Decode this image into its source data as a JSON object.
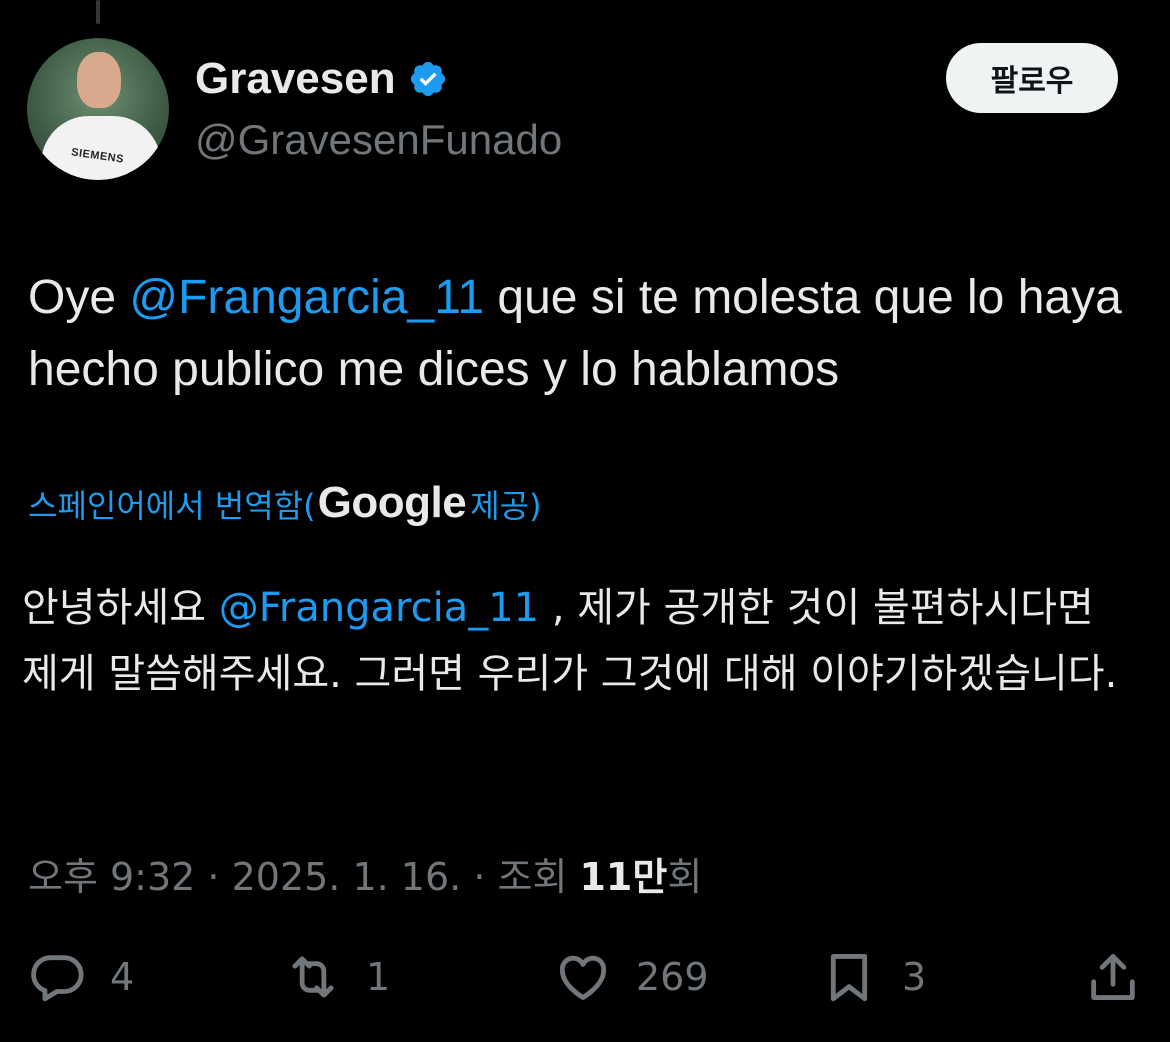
{
  "author": {
    "display_name": "Gravesen",
    "handle": "@GravesenFunado",
    "verified": true,
    "avatar_text": "SIEMENS"
  },
  "follow_label": "팔로우",
  "tweet": {
    "text_before_mention": "Oye ",
    "mention": "@Frangarcia_11",
    "text_after_mention": " que si te molesta que lo haya hecho publico me dices y lo hablamos"
  },
  "translation": {
    "label_prefix": "스페인어에서 번역함(",
    "provider": "Google",
    "label_suffix": " 제공)",
    "text_before_mention": "안녕하세요 ",
    "mention": "@Frangarcia_11",
    "text_after_mention": " , 제가 공개한 것이 불편하시다면 제게 말씀해주세요. 그러면 우리가 그것에 대해 이야기하겠습니다."
  },
  "meta": {
    "time": "오후 9:32",
    "separator": " · ",
    "date": "2025. 1. 16.",
    "views_label": "조회 ",
    "views_count": "11만",
    "views_suffix": "회"
  },
  "actions": {
    "replies": "4",
    "reposts": "1",
    "likes": "269",
    "bookmarks": "3"
  },
  "colors": {
    "background": "#000000",
    "text": "#e7e9ea",
    "secondary": "#71767b",
    "accent": "#1d9bf0"
  },
  "icons": [
    "verified-badge-icon",
    "reply-icon",
    "repost-icon",
    "like-icon",
    "bookmark-icon",
    "share-icon"
  ]
}
